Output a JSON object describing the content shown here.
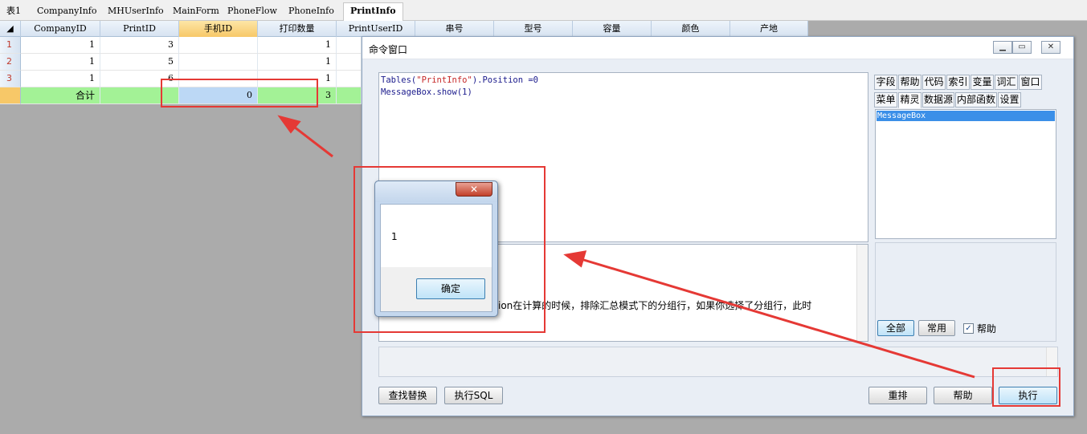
{
  "tabs": [
    "表1",
    "CompanyInfo",
    "MHUserInfo",
    "MainForm",
    "PhoneFlow",
    "PhoneInfo",
    "PrintInfo"
  ],
  "active_tab": "PrintInfo",
  "grid": {
    "columns": [
      "CompanyID",
      "PrintID",
      "手机ID",
      "打印数量",
      "PrintUserID",
      "串号",
      "型号",
      "容量",
      "颜色",
      "产地"
    ],
    "selected_column": "手机ID",
    "rows": [
      {
        "num": "1",
        "CompanyID": "1",
        "PrintID": "3",
        "PhoneID": "",
        "PrintQty": "1"
      },
      {
        "num": "2",
        "CompanyID": "1",
        "PrintID": "5",
        "PhoneID": "",
        "PrintQty": "1"
      },
      {
        "num": "3",
        "CompanyID": "1",
        "PrintID": "6",
        "PhoneID": "",
        "PrintQty": "1"
      }
    ],
    "summary": {
      "label": "合计",
      "PhoneID": "0",
      "PrintQty": "3"
    }
  },
  "command_window": {
    "title": "命令窗口",
    "code_line1_a": "Tables(",
    "code_line1_str": "\"PrintInfo\"",
    "code_line1_b": ").Position =0",
    "code_line2": "MessageBox.show(1)",
    "output_text": "ion在计算的时候，排除汇总模式下的分组行，如果你选择了分组行，此时",
    "panel_tabs_row1": [
      "字段",
      "帮助",
      "代码",
      "索引",
      "变量",
      "词汇",
      "窗口"
    ],
    "panel_tabs_row2": [
      "菜单",
      "精灵",
      "数据源",
      "内部函数",
      "设置"
    ],
    "active_panel_tab": "精灵",
    "list_items": [
      "MessageBox"
    ],
    "btn_all": "全部",
    "btn_common": "常用",
    "help_checkbox_label": "帮助",
    "help_checked": true,
    "btn_find_replace": "查找替换",
    "btn_exec_sql": "执行SQL",
    "btn_reorder": "重排",
    "btn_help": "帮助",
    "btn_execute": "执行"
  },
  "message_box": {
    "value": "1",
    "ok_label": "确定",
    "close_glyph": "✕"
  },
  "annotation_color": "#e53935"
}
